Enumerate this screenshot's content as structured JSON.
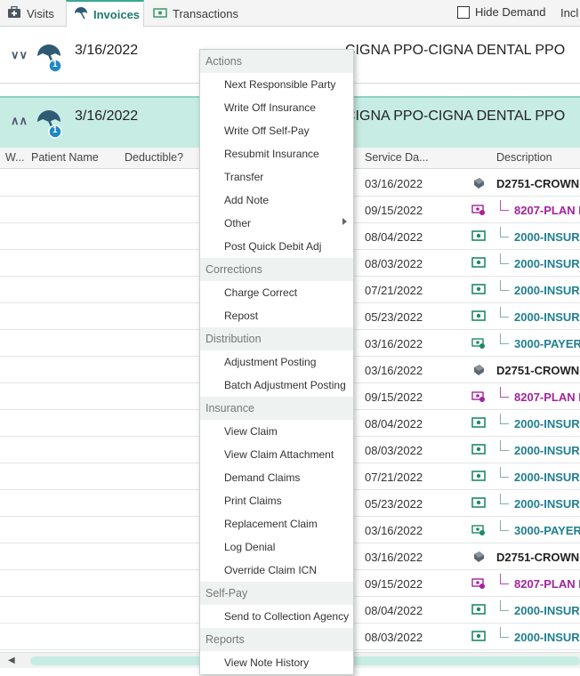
{
  "tabs": [
    {
      "label": "Visits",
      "icon": "medical-kit-icon"
    },
    {
      "label": "Invoices",
      "icon": "umbrella-icon",
      "active": true
    },
    {
      "label": "Transactions",
      "icon": "cash-icon"
    }
  ],
  "toolbar": {
    "hide_demand_label": "Hide Demand",
    "hide_demand_checked": false,
    "incl_label": "Incl"
  },
  "invoices": [
    {
      "date": "3/16/2022",
      "payer": "CIGNA PPO-CIGNA DENTAL PPO",
      "badge": "1",
      "expanded": false
    },
    {
      "date": "3/16/2022",
      "payer": "CIGNA PPO-CIGNA DENTAL PPO",
      "badge": "1",
      "expanded": true
    }
  ],
  "columns": [
    "W...",
    "Patient Name",
    "Deductible?",
    "Service Da...",
    "Description"
  ],
  "rows": [
    {
      "service_date": "03/16/2022",
      "icon": "procedure-icon",
      "description": "D2751-CROWN",
      "kind": "parent"
    },
    {
      "service_date": "09/15/2022",
      "icon": "payment-plan-icon",
      "description": "8207-PLAN P",
      "kind": "purple"
    },
    {
      "service_date": "08/04/2022",
      "icon": "cash-icon",
      "description": "2000-INSUR",
      "kind": "teal"
    },
    {
      "service_date": "08/03/2022",
      "icon": "cash-icon",
      "description": "2000-INSUR",
      "kind": "teal"
    },
    {
      "service_date": "07/21/2022",
      "icon": "cash-icon",
      "description": "2000-INSUR",
      "kind": "teal"
    },
    {
      "service_date": "05/23/2022",
      "icon": "cash-icon",
      "description": "2000-INSUR",
      "kind": "teal"
    },
    {
      "service_date": "03/16/2022",
      "icon": "payer-adjustment-icon",
      "description": "3000-PAYER",
      "kind": "teal"
    },
    {
      "service_date": "03/16/2022",
      "icon": "procedure-icon",
      "description": "D2751-CROWN",
      "kind": "parent"
    },
    {
      "service_date": "09/15/2022",
      "icon": "payment-plan-icon",
      "description": "8207-PLAN P",
      "kind": "purple"
    },
    {
      "service_date": "08/04/2022",
      "icon": "cash-icon",
      "description": "2000-INSUR",
      "kind": "teal"
    },
    {
      "service_date": "08/03/2022",
      "icon": "cash-icon",
      "description": "2000-INSUR",
      "kind": "teal"
    },
    {
      "service_date": "07/21/2022",
      "icon": "cash-icon",
      "description": "2000-INSUR",
      "kind": "teal"
    },
    {
      "service_date": "05/23/2022",
      "icon": "cash-icon",
      "description": "2000-INSUR",
      "kind": "teal"
    },
    {
      "service_date": "03/16/2022",
      "icon": "payer-adjustment-icon",
      "description": "3000-PAYER",
      "kind": "teal"
    },
    {
      "service_date": "03/16/2022",
      "icon": "procedure-icon",
      "description": "D2751-CROWN",
      "kind": "parent"
    },
    {
      "service_date": "09/15/2022",
      "icon": "payment-plan-icon",
      "description": "8207-PLAN P",
      "kind": "purple"
    },
    {
      "service_date": "08/04/2022",
      "icon": "cash-icon",
      "description": "2000-INSUR",
      "kind": "teal"
    },
    {
      "service_date": "08/03/2022",
      "icon": "cash-icon",
      "description": "2000-INSUR",
      "kind": "teal"
    }
  ],
  "context_menu": {
    "sections": [
      {
        "title": "Actions",
        "items": [
          {
            "label": "Next Responsible Party"
          },
          {
            "label": "Write Off Insurance"
          },
          {
            "label": "Write Off Self-Pay"
          },
          {
            "label": "Resubmit Insurance"
          },
          {
            "label": "Transfer"
          },
          {
            "label": "Add Note"
          },
          {
            "label": "Other",
            "submenu": true
          },
          {
            "label": "Post Quick Debit Adj"
          }
        ]
      },
      {
        "title": "Corrections",
        "items": [
          {
            "label": "Charge Correct"
          },
          {
            "label": "Repost"
          }
        ]
      },
      {
        "title": "Distribution",
        "items": [
          {
            "label": "Adjustment Posting"
          },
          {
            "label": "Batch Adjustment Posting"
          }
        ]
      },
      {
        "title": "Insurance",
        "items": [
          {
            "label": "View Claim"
          },
          {
            "label": "View Claim Attachment"
          },
          {
            "label": "Demand Claims"
          },
          {
            "label": "Print Claims"
          },
          {
            "label": "Replacement Claim"
          },
          {
            "label": "Log Denial"
          },
          {
            "label": "Override Claim ICN"
          }
        ]
      },
      {
        "title": "Self-Pay",
        "items": [
          {
            "label": "Send to Collection Agency"
          }
        ]
      },
      {
        "title": "Reports",
        "items": [
          {
            "label": "View Note History"
          }
        ]
      }
    ]
  },
  "colors": {
    "accent": "#3aa994",
    "selected_row": "#c6ece3",
    "teal_text": "#1f7f8f",
    "purple_text": "#a3239d"
  }
}
